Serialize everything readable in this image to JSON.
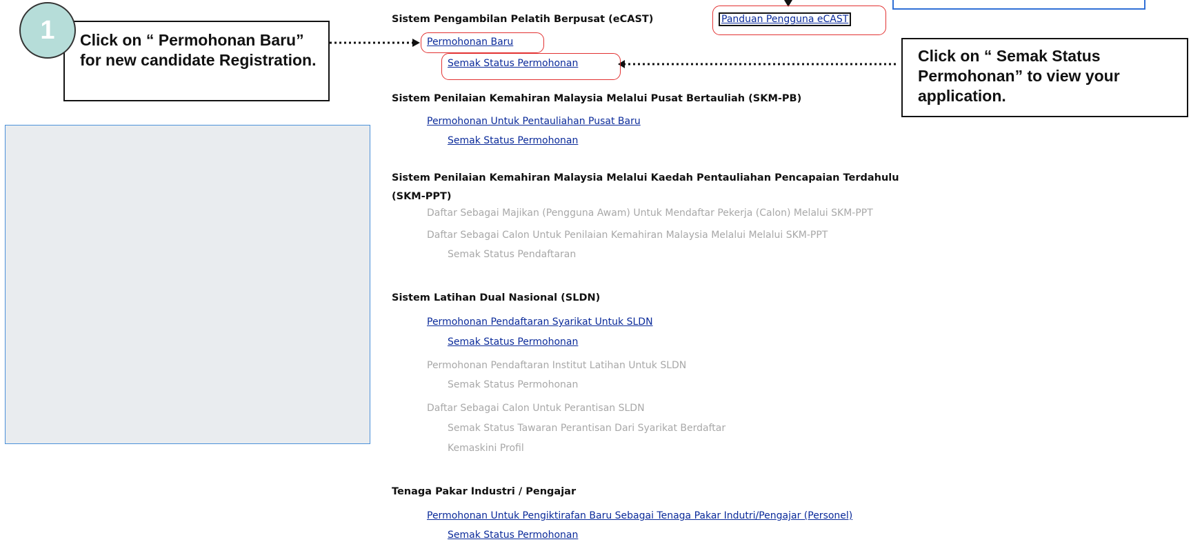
{
  "callouts": {
    "step_number": "1",
    "new_registration": "Click on “ Permohonan Baru” for new candidate Registration.",
    "check_status": "Click on “ Semak Status Permohonan” to view your application."
  },
  "ecast": {
    "heading": "Sistem Pengambilan Pelatih Berpusat (eCAST)",
    "guide_link": "Panduan Pengguna eCAST",
    "new_application": "Permohonan Baru",
    "check_status": "Semak Status Permohonan"
  },
  "skm_pb": {
    "heading": "Sistem Penilaian Kemahiran Malaysia Melalui Pusat Bertauliah (SKM-PB)",
    "new_center_application": "Permohonan Untuk Pentauliahan Pusat Baru",
    "check_status": "Semak Status Permohonan"
  },
  "skm_ppt": {
    "heading_line1": "Sistem Penilaian Kemahiran Malaysia Melalui Kaedah Pentauliahan Pencapaian Terdahulu",
    "heading_line2": "(SKM-PPT)",
    "employer_register": "Daftar Sebagai Majikan (Pengguna Awam) Untuk Mendaftar Pekerja (Calon) Melalui SKM-PPT",
    "candidate_register": "Daftar Sebagai Calon Untuk Penilaian Kemahiran Malaysia Melalui Melalui SKM-PPT",
    "check_registration": "Semak Status Pendaftaran"
  },
  "sldn": {
    "heading": "Sistem Latihan Dual Nasional (SLDN)",
    "company_registration": "Permohonan Pendaftaran Syarikat Untuk SLDN",
    "company_check_status": "Semak Status Permohonan",
    "institute_registration": "Permohonan Pendaftaran Institut Latihan Untuk SLDN",
    "institute_check_status": "Semak Status Permohonan",
    "apprentice_register": "Daftar Sebagai Calon Untuk Perantisan SLDN",
    "offer_status": "Semak Status Tawaran Perantisan Dari Syarikat Berdaftar",
    "update_profile": "Kemaskini Profil"
  },
  "experts": {
    "heading": "Tenaga Pakar Industri / Pengajar",
    "new_recognition": "Permohonan Untuk Pengiktirafan Baru Sebagai Tenaga Pakar Indutri/Pengajar (Personel)",
    "check_status": "Semak Status Permohonan"
  },
  "colors": {
    "link": "#0a2a9a",
    "disabled": "#a8a8a8",
    "highlight": "#e23030",
    "step_circle": "#b6ddd9",
    "panel_bg": "#e9ecef",
    "panel_border": "#4a90d9"
  }
}
